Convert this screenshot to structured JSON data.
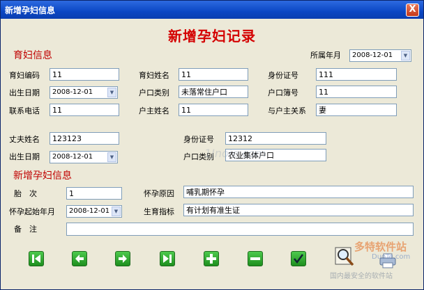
{
  "window": {
    "title": "新增孕妇信息",
    "close_glyph": "X"
  },
  "form_title": "新增孕妇记录",
  "pregnant_section": {
    "heading": "育妇信息",
    "belong_month_label": "所属年月",
    "belong_month_value": "2008-12-01",
    "code_label": "育妇编码",
    "code_value": "11",
    "name_label": "育妇姓名",
    "name_value": "11",
    "id_label": "身份证号",
    "id_value": "111",
    "birth_label": "出生日期",
    "birth_value": "2008-12-01",
    "hukou_type_label": "户口类别",
    "hukou_type_value": "未落常住户口",
    "hukou_book_label": "户口簿号",
    "hukou_book_value": "11",
    "phone_label": "联系电话",
    "phone_value": "11",
    "householder_label": "户主姓名",
    "householder_value": "11",
    "relation_label": "与户主关系",
    "relation_value": "妻"
  },
  "husband_section": {
    "name_label": "丈夫姓名",
    "name_value": "123123",
    "id_label": "身份证号",
    "id_value": "12312",
    "birth_label": "出生日期",
    "birth_value": "2008-12-01",
    "hukou_type_label": "户口类别",
    "hukou_type_value": "农业集体户口"
  },
  "pregnancy_section": {
    "heading": "新增孕妇信息",
    "parity_label": "胎　次",
    "parity_value": "1",
    "reason_label": "怀孕原因",
    "reason_value": "哺乳期怀孕",
    "start_label": "怀孕起始年月",
    "start_value": "2008-12-01",
    "quota_label": "生育指标",
    "quota_value": "有计划有准生证",
    "remark_label": "备　注",
    "remark_value": ""
  },
  "toolbar": {
    "icons": [
      "first-record-icon",
      "previous-record-icon",
      "next-record-icon",
      "last-record-icon",
      "add-record-icon",
      "delete-record-icon",
      "save-check-icon",
      "search-icon",
      "print-icon"
    ]
  },
  "watermark": {
    "brand": "多特软件站",
    "url": "DuoTe.com",
    "slogan": "国内最安全的软件站",
    "mid_mark": "1Jnoie.com"
  },
  "colors": {
    "title_red": "#d40000",
    "section_red": "#c00000",
    "nav_green": "#1e8f1e",
    "titlebar_blue": "#0b47c4"
  }
}
